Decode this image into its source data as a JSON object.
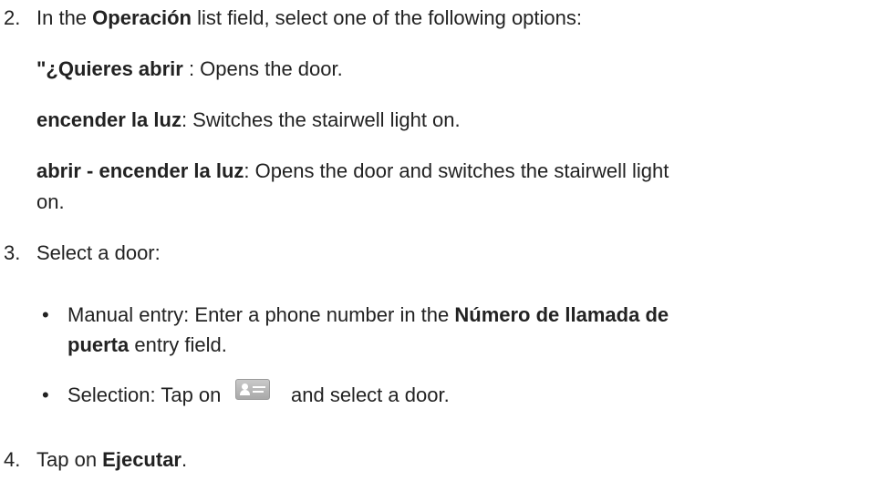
{
  "steps": {
    "step2": {
      "number": "2.",
      "text_before": "In the ",
      "field_name": "Operación",
      "text_after": " list field, select one of the following options:",
      "options": [
        {
          "label": "\"¿Quieres abrir",
          "description": " : Opens the door."
        },
        {
          "label": "encender la luz",
          "description": ": Switches the stairwell light on."
        },
        {
          "label": "abrir - encender la luz",
          "description": ": Opens the door and switches the stairwell light",
          "description_cont": "on."
        }
      ]
    },
    "step3": {
      "number": "3.",
      "text": "Select a door:",
      "bullets": [
        {
          "marker": "•",
          "text_before": "Manual entry: Enter a phone number in the ",
          "field_name": "Número de llamada de",
          "field_name_cont": "puerta",
          "text_after": " entry field."
        },
        {
          "marker": "•",
          "text_before": "Selection: Tap on",
          "icon": "contact-card-icon",
          "text_after": "and select a door."
        }
      ]
    },
    "step4": {
      "number": "4.",
      "text_before": "Tap on ",
      "button_name": "Ejecutar",
      "text_after": "."
    }
  }
}
